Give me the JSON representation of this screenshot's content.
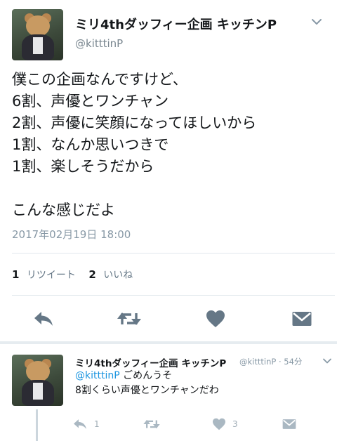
{
  "tweet": {
    "display_name": "ミリ4thダッフィー企画 キッチンP",
    "handle": "@kitttinP",
    "lines": [
      "僕この企画なんですけど、",
      "6割、声優とワンチャン",
      "2割、声優に笑顔になってほしいから",
      "1割、なんか思いつきで",
      "1割、楽しそうだから",
      "",
      "こんな感じだよ"
    ],
    "timestamp": "2017年02月19日 18:00",
    "retweet_count": "1",
    "retweet_label": "リツイート",
    "like_count": "2",
    "like_label": "いいね",
    "icons": [
      "reply-icon",
      "retweet-icon",
      "like-icon",
      "direct-message-icon",
      "chevron-down-icon"
    ]
  },
  "reply": {
    "display_name": "ミリ4thダッフィー企画 キッチンP",
    "meta": "@kitttinP · 54分",
    "mention": "@kitttinP",
    "text_after_mention": " ごめんうそ",
    "line2": "8割くらい声優とワンチャンだわ",
    "retweet_count": "1",
    "like_count": "3"
  },
  "colors": {
    "text": "#14171a",
    "secondary": "#8899a6",
    "icon": "#657786",
    "icon_light": "#aab8c2",
    "link": "#1b95e0",
    "divider": "#e1e8ed"
  }
}
